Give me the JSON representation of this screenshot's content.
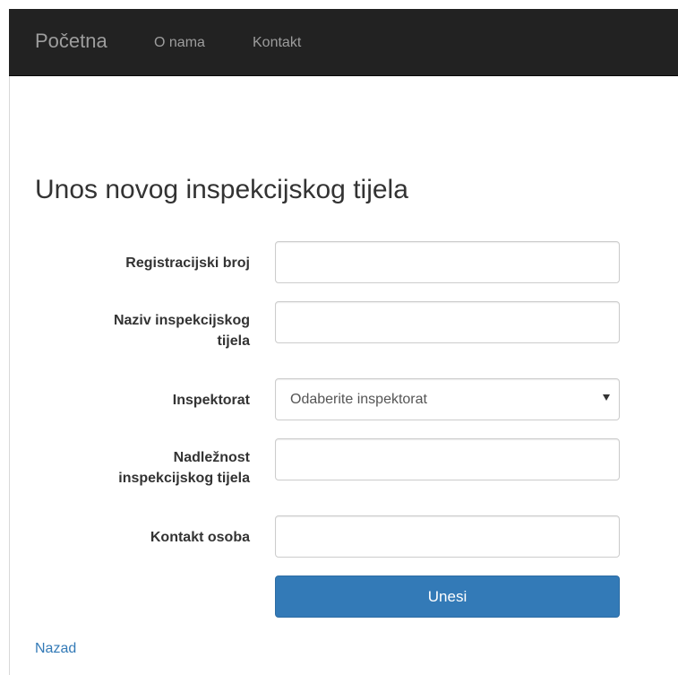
{
  "navbar": {
    "brand": "Početna",
    "links": [
      {
        "label": "O nama"
      },
      {
        "label": "Kontakt"
      }
    ]
  },
  "page": {
    "title": "Unos novog inspekcijskog tijela"
  },
  "form": {
    "fields": [
      {
        "label": "Registracijski broj",
        "value": "",
        "placeholder": ""
      },
      {
        "label_line1": "Naziv inspekcijskog",
        "label_line2": "tijela",
        "value": "",
        "placeholder": ""
      },
      {
        "label": "Inspektorat",
        "selected": "Odaberite inspektorat"
      },
      {
        "label_line1": "Nadležnost",
        "label_line2": "inspekcijskog tijela",
        "value": "",
        "placeholder": ""
      },
      {
        "label": "Kontakt osoba",
        "value": "",
        "placeholder": ""
      }
    ],
    "submit_label": "Unesi"
  },
  "footer": {
    "back_label": "Nazad"
  },
  "colors": {
    "navbar_bg": "#222222",
    "nav_text": "#9d9d9d",
    "primary": "#337ab7",
    "link": "#337ab7"
  },
  "icons": {
    "select_arrow": "caret-down-icon"
  }
}
